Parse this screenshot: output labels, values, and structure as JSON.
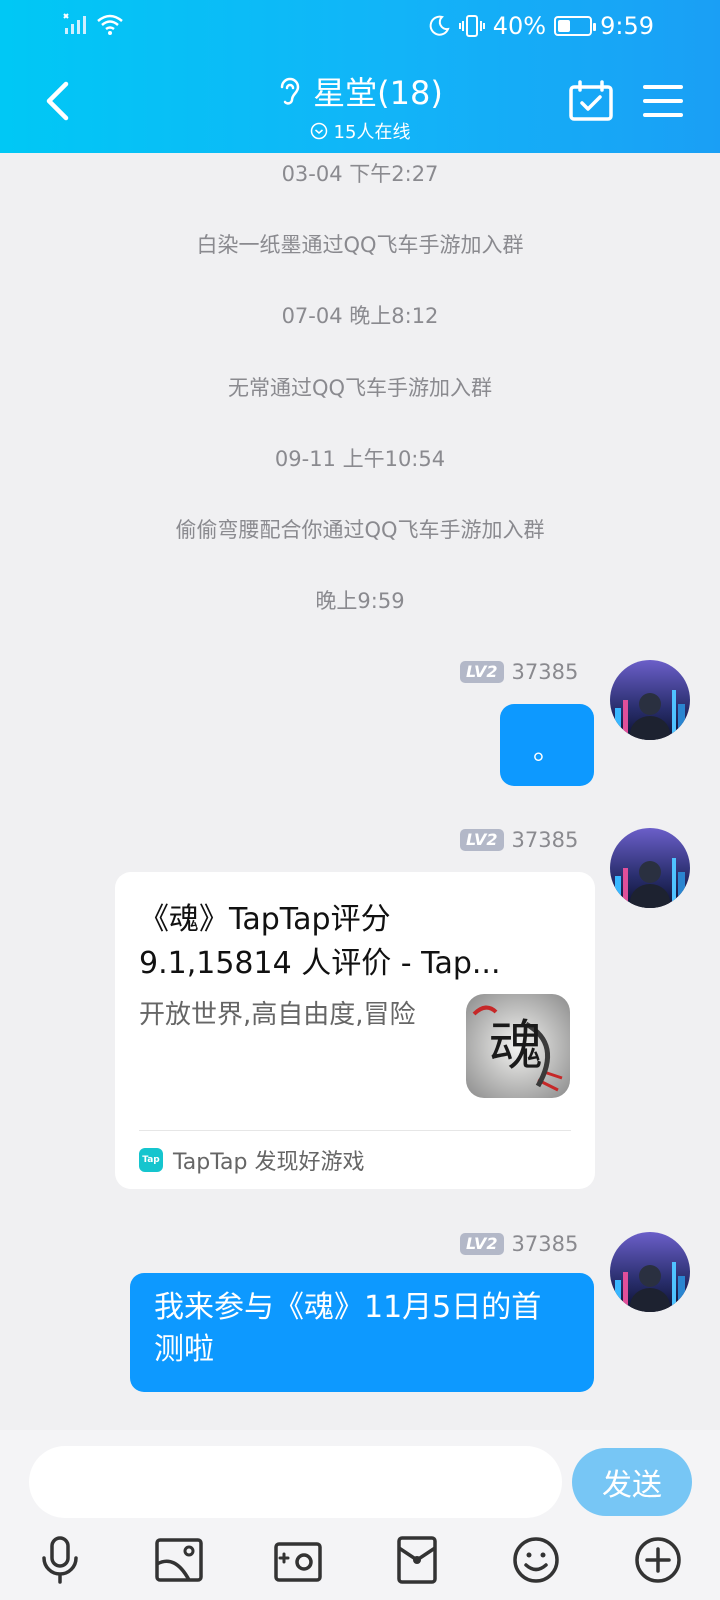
{
  "status_bar": {
    "battery_percent": "40%",
    "battery_level": 0.4,
    "time": "9:59"
  },
  "header": {
    "title": "星堂(18)",
    "online": "15人在线"
  },
  "system_messages": [
    "03-04 下午2:27",
    "白染一纸墨通过QQ飞车手游加入群",
    "07-04 晚上8:12",
    "无常通过QQ飞车手游加入群",
    "09-11 上午10:54",
    "偷偷弯腰配合你通过QQ飞车手游加入群",
    "晚上9:59"
  ],
  "messages": [
    {
      "level": "LV2",
      "sender": "37385",
      "text": "。"
    },
    {
      "level": "LV2",
      "sender": "37385",
      "card": {
        "title_line1": "《魂》TapTap评分",
        "title_line2": "9.1,15814 人评价 - Tap...",
        "description": "开放世界,高自由度,冒险",
        "thumbnail_glyph": "魂",
        "source_logo": "Tap",
        "source": "TapTap 发现好游戏"
      }
    },
    {
      "level": "LV2",
      "sender": "37385",
      "text": "我来参与《魂》11月5日的首测啦"
    }
  ],
  "input": {
    "value": "",
    "placeholder": "",
    "send_label": "发送"
  },
  "toolbar": [
    "mic-icon",
    "image-icon",
    "camera-icon",
    "red-packet-icon",
    "emoji-icon",
    "plus-icon"
  ],
  "colors": {
    "header_start": "#00c8f5",
    "header_end": "#1a9ff5",
    "bubble": "#0d99ff",
    "send_button": "#77c6f5",
    "level_badge": "#b3b8c8"
  }
}
